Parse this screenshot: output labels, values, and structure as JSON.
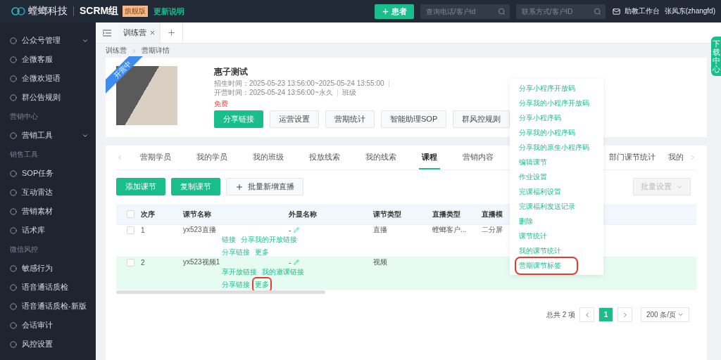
{
  "header": {
    "brand": "螳螂科技",
    "product": "SCRM组",
    "edition": "旗舰版",
    "release_notes": "更新说明",
    "add_button": "患者",
    "search_phone": {
      "placeholder": "查询电话/客户id"
    },
    "search_contact": {
      "placeholder": "联系方式/客户ID"
    },
    "workbench": "助教工作台",
    "user": "张凤东(zhangfd)"
  },
  "sidebar": {
    "items": [
      {
        "kind": "item",
        "label": "公众号管理",
        "expandable": true
      },
      {
        "kind": "item",
        "label": "企微客服",
        "expandable": false
      },
      {
        "kind": "item",
        "label": "企微欢迎语",
        "expandable": false
      },
      {
        "kind": "item",
        "label": "群公告规则",
        "expandable": false
      },
      {
        "kind": "section",
        "label": "营销中心"
      },
      {
        "kind": "item",
        "label": "营销工具",
        "expandable": true
      },
      {
        "kind": "section",
        "label": "销售工具"
      },
      {
        "kind": "item",
        "label": "SOP任务",
        "expandable": false
      },
      {
        "kind": "item",
        "label": "互动雷达",
        "expandable": false
      },
      {
        "kind": "item",
        "label": "营销素材",
        "expandable": false
      },
      {
        "kind": "item",
        "label": "话术库",
        "expandable": false
      },
      {
        "kind": "section",
        "label": "微信风控"
      },
      {
        "kind": "item",
        "label": "敏感行为",
        "expandable": false
      },
      {
        "kind": "item",
        "label": "语音通话质检",
        "expandable": false
      },
      {
        "kind": "item",
        "label": "语音通话质检-新版",
        "expandable": false
      },
      {
        "kind": "item",
        "label": "会话审计",
        "expandable": false
      },
      {
        "kind": "item",
        "label": "风控设置",
        "expandable": false
      }
    ]
  },
  "page_tabs": [
    {
      "label": "训练营",
      "selected": true
    }
  ],
  "breadcrumb": [
    "训练营",
    "营期详情"
  ],
  "camp": {
    "ribbon": "开营中",
    "title": "惠子测试",
    "info": [
      "招生时间：2025-05-23 13:56:00~2025-05-24 13:55:00",
      "开营时间：2025-05-24 13:56:00~永久",
      "班级"
    ],
    "price": "免费",
    "buttons": [
      {
        "label": "分享链接",
        "primary": true
      },
      {
        "label": "运营设置",
        "primary": false
      },
      {
        "label": "营期统计",
        "primary": false
      },
      {
        "label": "智能助理SOP",
        "primary": false
      },
      {
        "label": "群风控规则",
        "primary": false
      }
    ]
  },
  "detail_tabs": [
    {
      "label": "营期学员",
      "selected": false
    },
    {
      "label": "我的学员",
      "selected": false
    },
    {
      "label": "我的班级",
      "selected": false
    },
    {
      "label": "投放线索",
      "selected": false
    },
    {
      "label": "我的线索",
      "selected": false
    },
    {
      "label": "课程",
      "selected": true
    },
    {
      "label": "营销内容",
      "selected": false
    },
    {
      "label": "部门课节统计",
      "selected": false
    },
    {
      "label": "我的",
      "selected": false
    }
  ],
  "toolbar": {
    "buttons": [
      {
        "label": "添加课节",
        "primary": true
      },
      {
        "label": "复制课节",
        "primary": true
      },
      {
        "label": "批量新增直播",
        "primary": false
      }
    ],
    "batch": {
      "label": "批量设置",
      "disabled": true
    }
  },
  "table": {
    "all_checked": false,
    "columns": [
      "次序",
      "课节名称",
      "外显名称",
      "课节类型",
      "直播类型",
      "直播模"
    ],
    "rows": [
      {
        "checked": false,
        "hovered": false,
        "cells": [
          "1",
          "yx523直播",
          "-",
          "直播",
          "螳螂客户...",
          "二分屏"
        ],
        "actions": [
          [
            {
              "label": "链接",
              "marked": false
            },
            {
              "label": "分享我的开放链接",
              "marked": false
            }
          ],
          [
            {
              "label": "分享链接",
              "marked": false
            },
            {
              "label": "更多",
              "marked": false
            }
          ]
        ]
      },
      {
        "checked": false,
        "hovered": true,
        "cells": [
          "2",
          "yx523视频1",
          "-",
          "视频",
          "",
          ""
        ],
        "actions": [
          [
            {
              "label": "享开放链接",
              "marked": false
            },
            {
              "label": "我的邀课链接",
              "marked": false
            }
          ],
          [
            {
              "label": "分享链接",
              "marked": false
            },
            {
              "label": "更多",
              "marked": true
            }
          ]
        ]
      }
    ]
  },
  "pagination": {
    "total": "总共 2 项",
    "pages": [
      {
        "label": "1",
        "selected": true
      }
    ],
    "page_size": "200 条/页"
  },
  "more_menu": [
    {
      "label": "分享小程序开放码",
      "marked": false
    },
    {
      "label": "分享我的小程序开放码",
      "marked": false
    },
    {
      "label": "分享小程序码",
      "marked": false
    },
    {
      "label": "分享我的小程序码",
      "marked": false
    },
    {
      "label": "分享我的原生小程序码",
      "marked": false
    },
    {
      "label": "编辑课节",
      "marked": false
    },
    {
      "label": "作业设置",
      "marked": false
    },
    {
      "label": "完课福利设置",
      "marked": false
    },
    {
      "label": "完课福利发送记录",
      "marked": false
    },
    {
      "label": "删除",
      "marked": false
    },
    {
      "label": "课节统计",
      "marked": false
    },
    {
      "label": "我的课节统计",
      "marked": false
    },
    {
      "label": "营期课节标签",
      "marked": true
    }
  ],
  "download_center": "下载中心"
}
